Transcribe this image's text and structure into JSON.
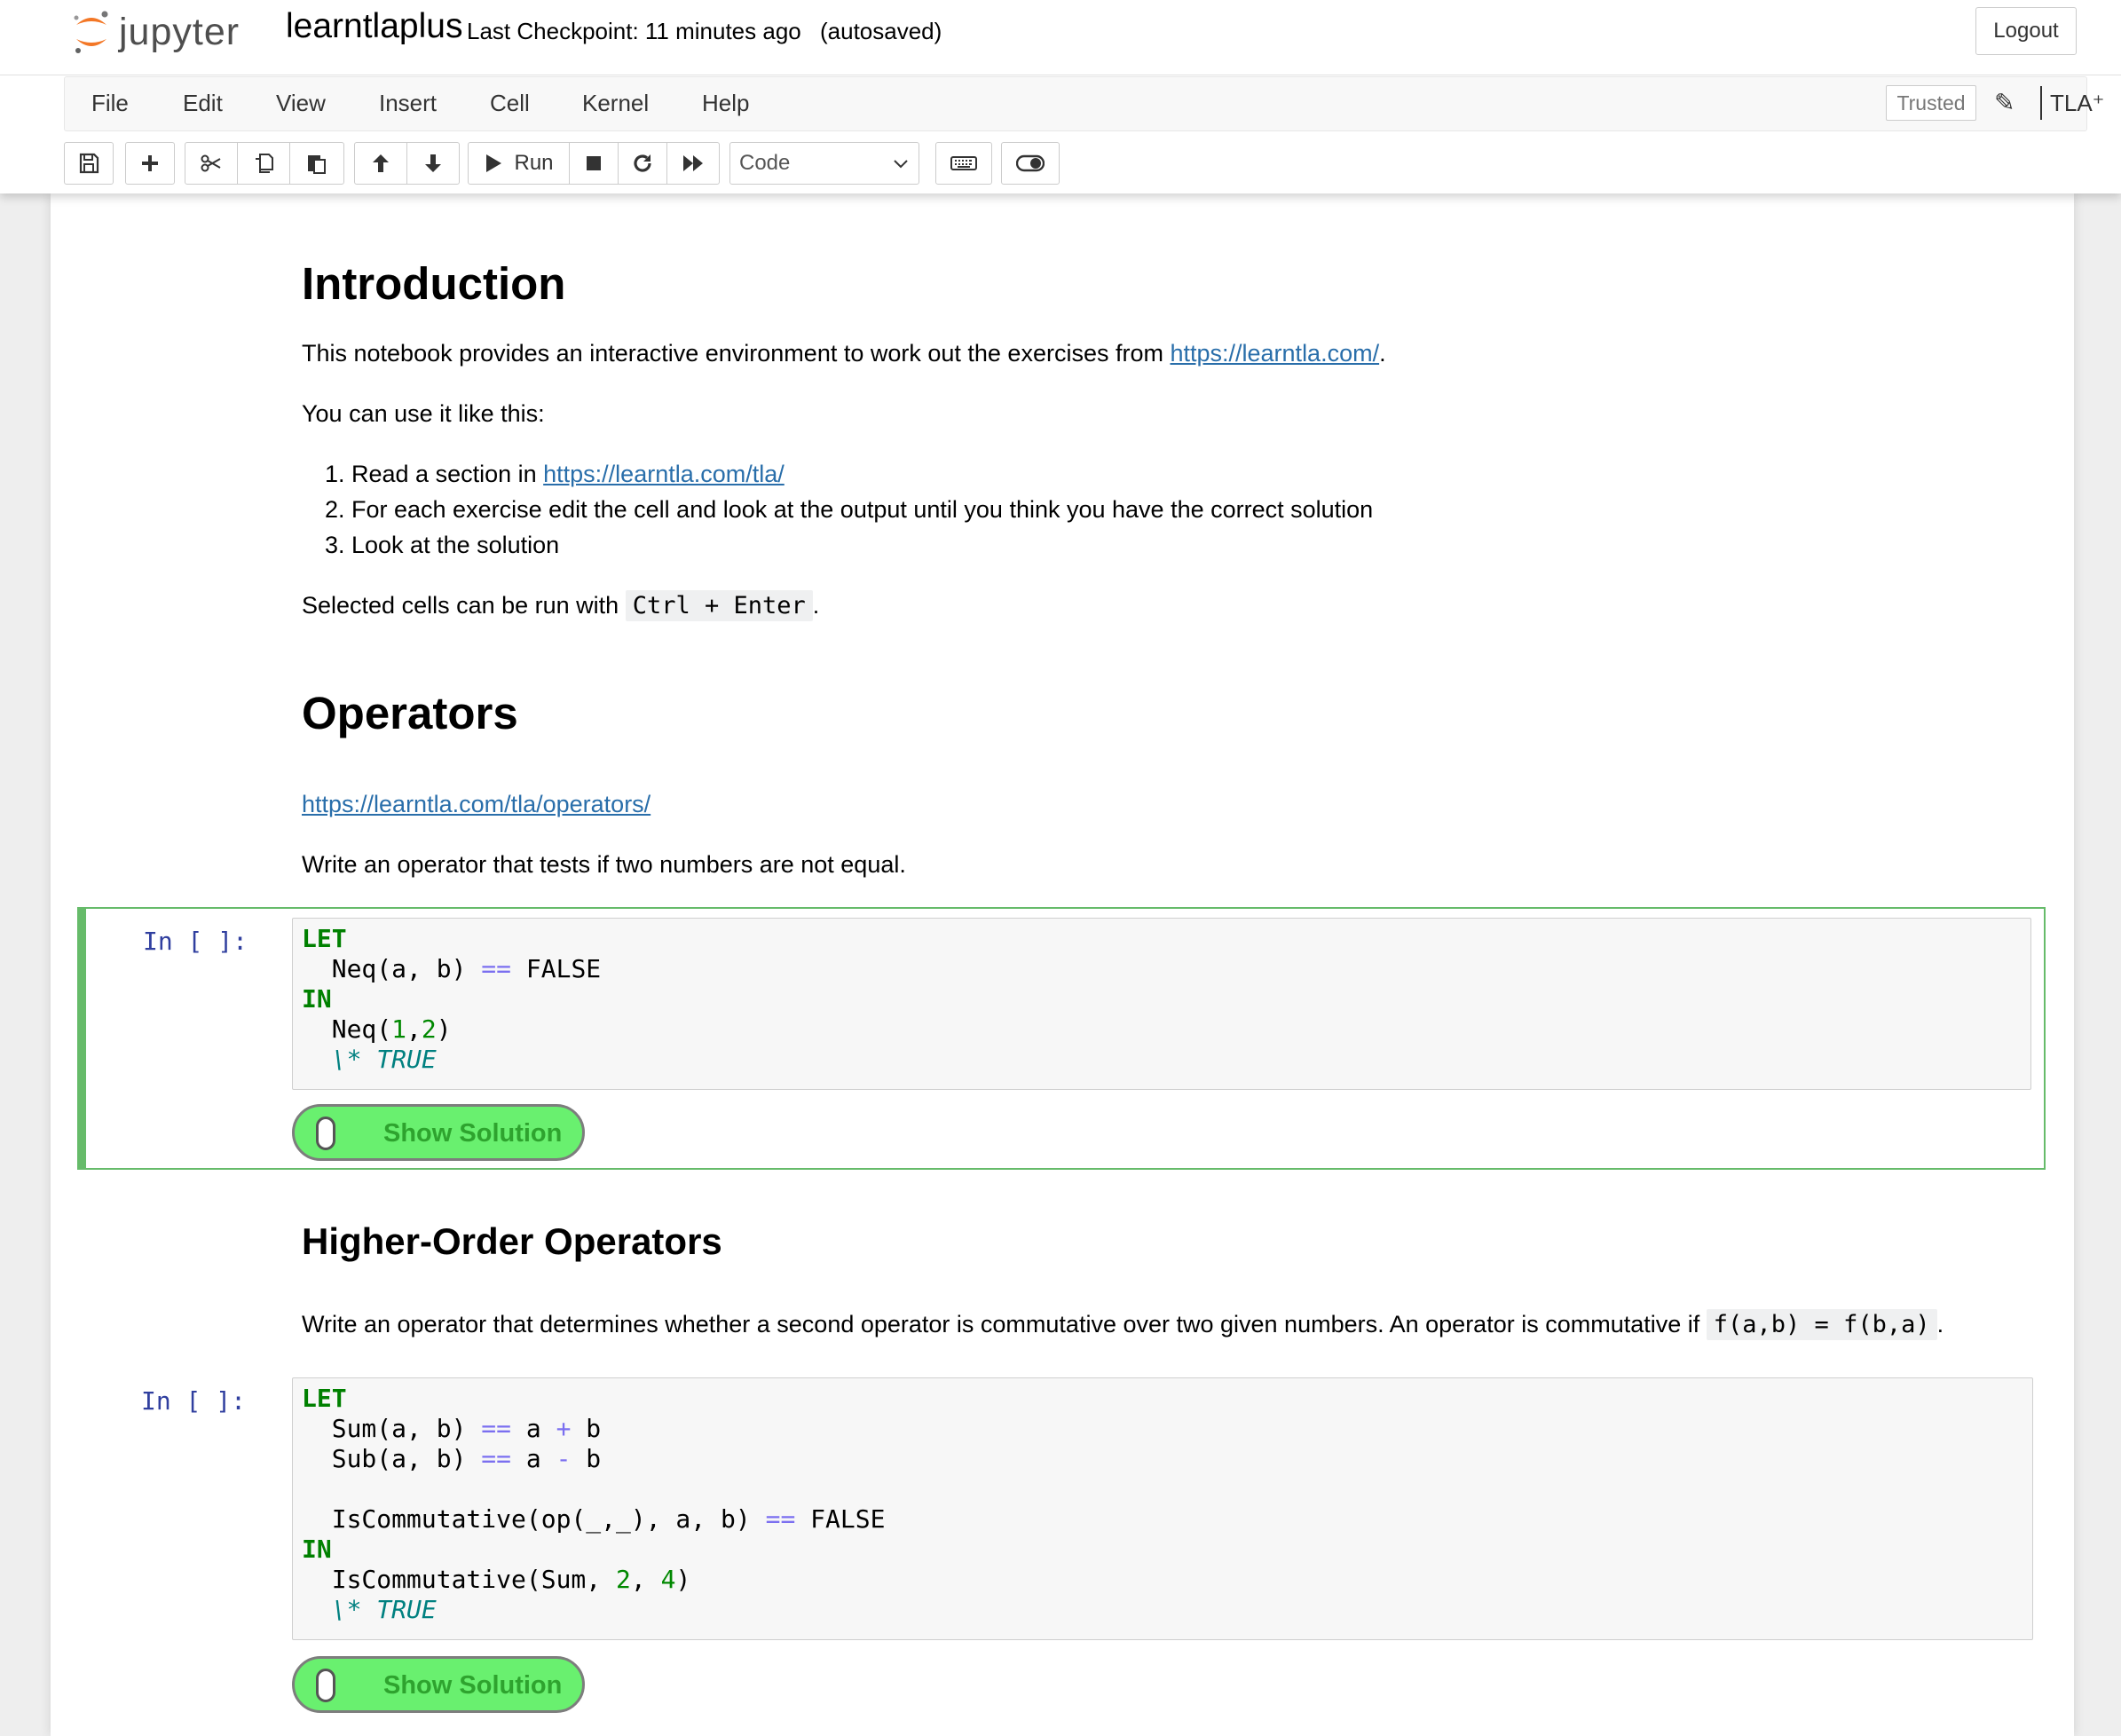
{
  "header": {
    "logo_text": "jupyter",
    "notebook_name": "learntlaplus",
    "checkpoint": "Last Checkpoint: 11 minutes ago",
    "autosave": "(autosaved)",
    "logout": "Logout"
  },
  "menubar": {
    "items": [
      "File",
      "Edit",
      "View",
      "Insert",
      "Cell",
      "Kernel",
      "Help"
    ],
    "trusted": "Trusted",
    "kernel_name": "TLA⁺"
  },
  "toolbar": {
    "run_label": "Run",
    "cell_type": "Code"
  },
  "notebook": {
    "intro_heading": "Introduction",
    "intro_text": "This notebook provides an interactive environment to work out the exercises from ",
    "intro_link": "https://learntla.com/",
    "intro_text_end": ".",
    "usage_text": "You can use it like this:",
    "steps": [
      {
        "text": "Read a section in ",
        "link": "https://learntla.com/tla/"
      },
      {
        "text": "For each exercise edit the cell and look at the output until you think you have the correct solution"
      },
      {
        "text": "Look at the solution"
      }
    ],
    "run_text": "Selected cells can be run with ",
    "run_shortcut": "Ctrl + Enter",
    "run_text_end": ".",
    "operators_heading": "Operators",
    "operators_link": "https://learntla.com/tla/operators/",
    "operators_task": "Write an operator that tests if two numbers are not equal.",
    "cell1_prompt": "In [ ]:",
    "show_solution": "Show Solution",
    "hoo_heading": "Higher-Order Operators",
    "hoo_task": "Write an operator that determines whether a second operator is commutative over two given numbers. An operator is commutative if ",
    "hoo_code_inline": "f(a,b) = f(b,a)",
    "hoo_task_end": ".",
    "cell2_prompt": "In [ ]:"
  },
  "colors": {
    "selected_cell_border": "#66bb6a",
    "link": "#296eaa",
    "prompt": "#303f9f",
    "solution_button": "#69f06f"
  },
  "icons": [
    "save-icon",
    "plus-icon",
    "cut-icon",
    "copy-icon",
    "paste-icon",
    "arrow-up-icon",
    "arrow-down-icon",
    "play-icon",
    "stop-icon",
    "restart-icon",
    "fast-forward-icon",
    "keyboard-icon",
    "toggle-icon",
    "pencil-icon",
    "kernel-status-icon"
  ]
}
